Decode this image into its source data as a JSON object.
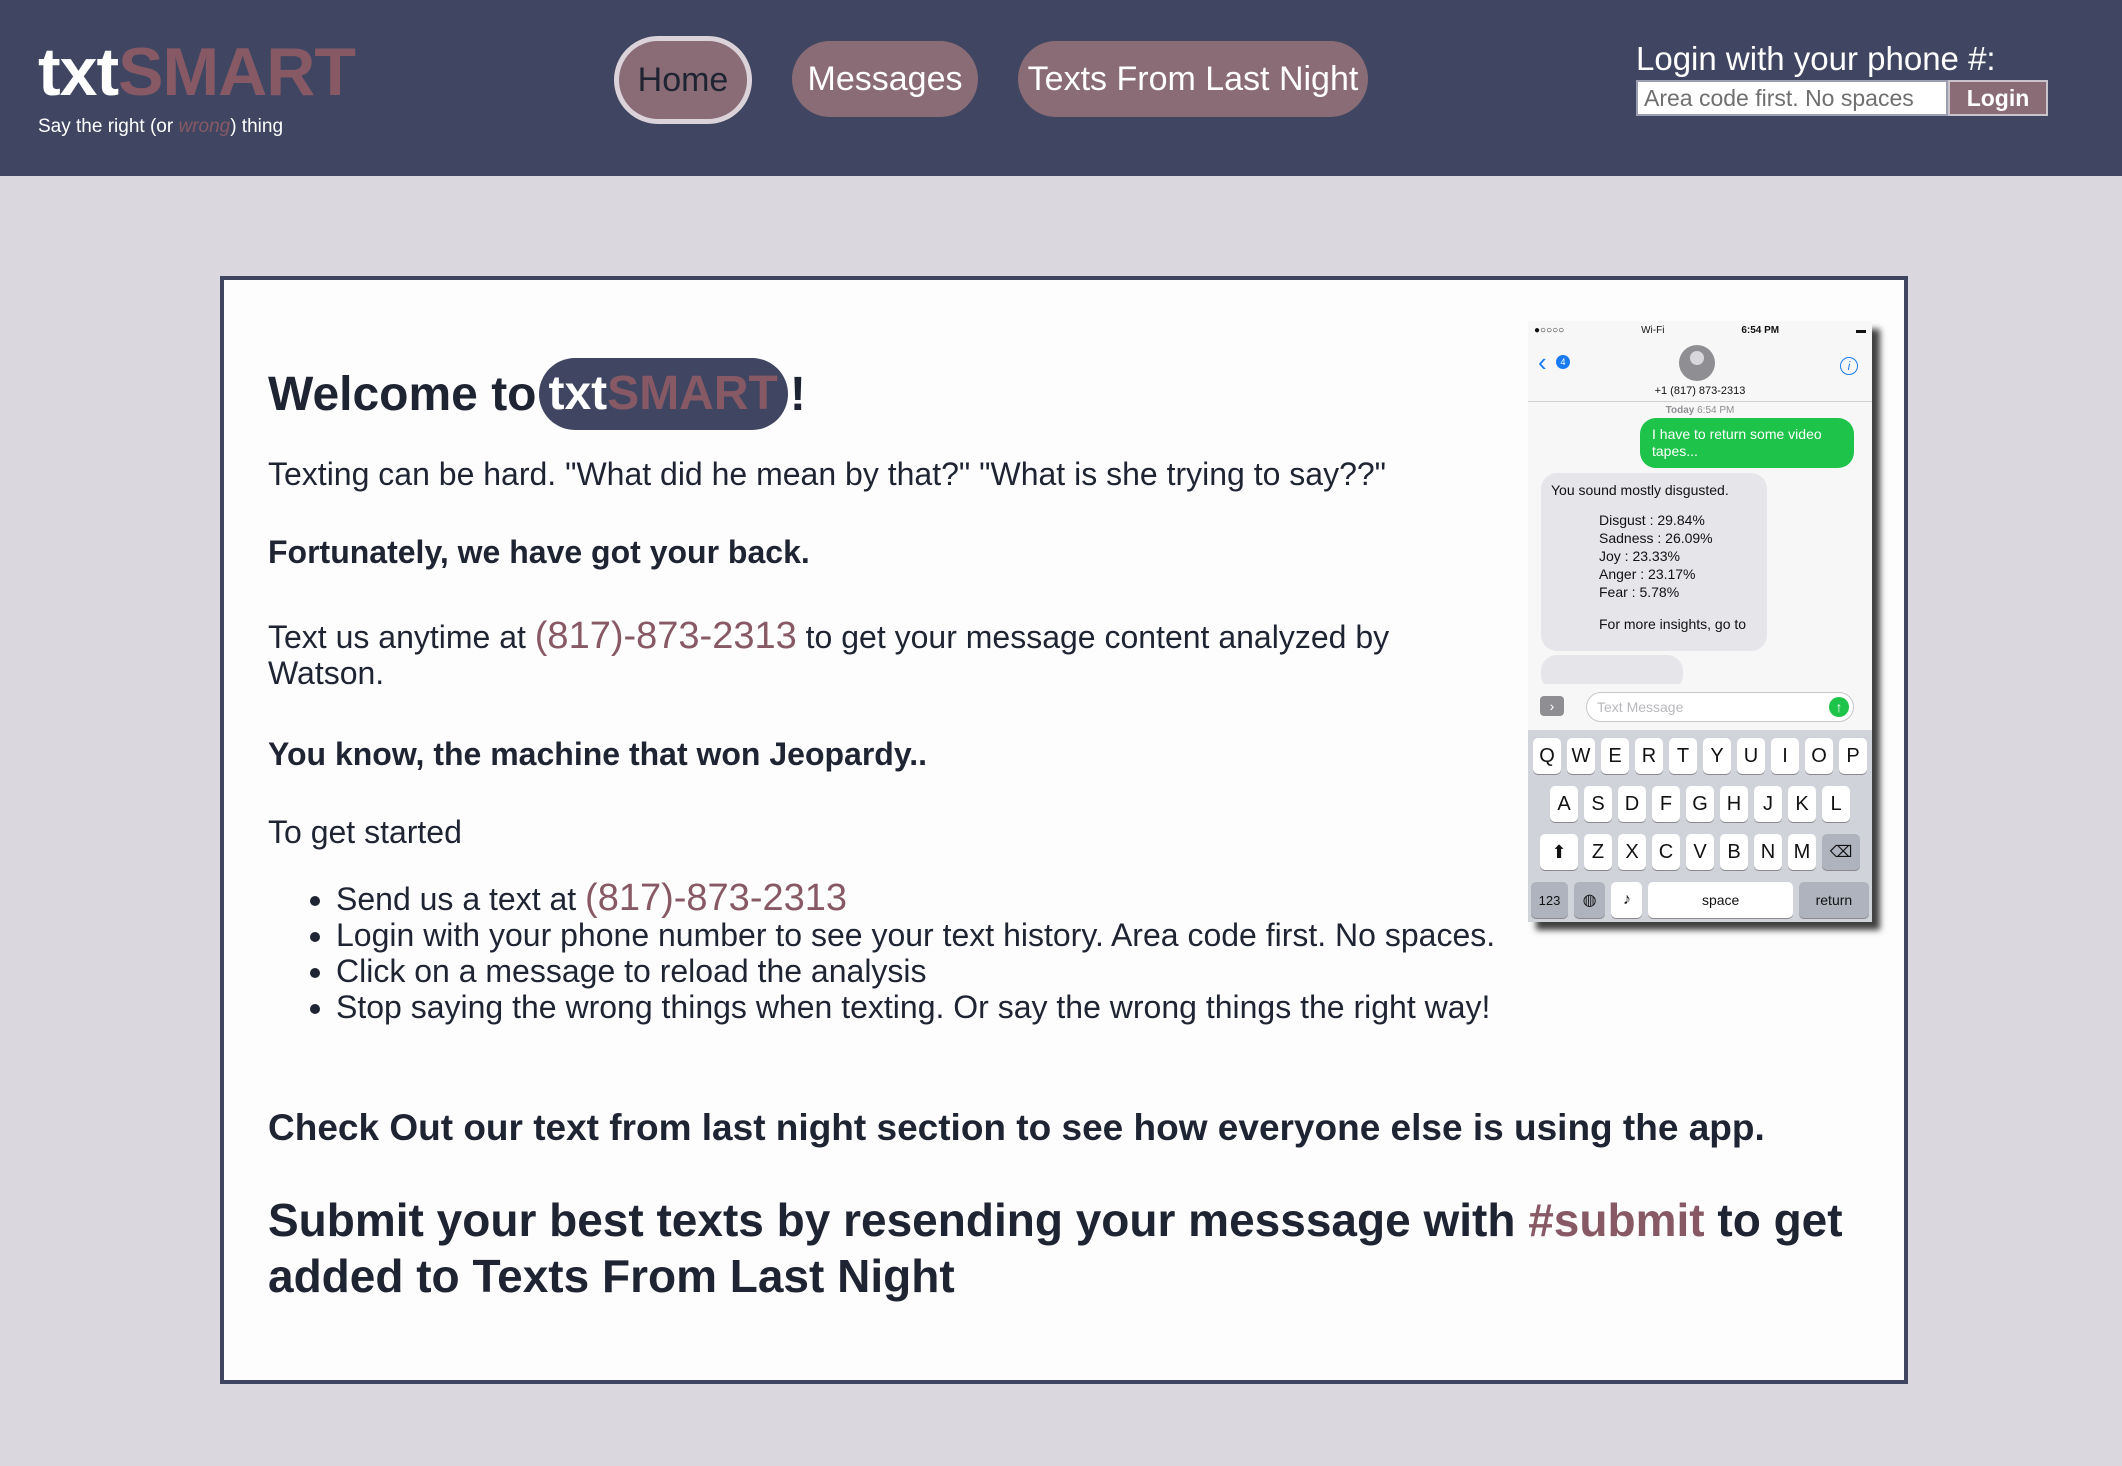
{
  "brand": {
    "name_prefix": "txt",
    "name_suffix": "SMART",
    "tagline_start": "Say the right (or ",
    "tagline_emphasis": "wrong",
    "tagline_end": ") thing",
    "colors": {
      "header_bg": "#404661",
      "accent": "#875965",
      "page_bg": "#dad7df",
      "nav_button": "#8a6c76"
    }
  },
  "nav": {
    "items": [
      {
        "label": "Home",
        "active": true
      },
      {
        "label": "Messages",
        "active": false
      },
      {
        "label": "Texts From Last Night",
        "active": false
      }
    ]
  },
  "login": {
    "label": "Login with your phone #:",
    "placeholder": "Area code first. No spaces",
    "button": "Login"
  },
  "content": {
    "welcome_prefix": "Welcome to",
    "welcome_suffix": "!",
    "intro": "Texting can be hard. \"What did he mean by that?\" \"What is she trying to say??\"",
    "fortunately": "Fortunately, we have got your back.",
    "text_us_before": "Text us anytime at ",
    "phone_number": "(817)-873-2313",
    "text_us_after": " to get your message content analyzed by Watson.",
    "jeopardy": "You know, the machine that won Jeopardy..",
    "to_get_started": "To get started",
    "steps": [
      "Send us a text at ",
      "Login with your phone number to see your text history. Area code first. No spaces.",
      "Click on a message to reload the analysis",
      "Stop saying the wrong things when texting. Or say the wrong things the right way!"
    ],
    "check_out": "Check Out our text from last night section to see how everyone else is using the app.",
    "submit_before": "Submit your best texts by resending your messsage with ",
    "submit_tag": "#submit",
    "submit_after": " to get added to Texts From Last Night"
  },
  "phone_screenshot": {
    "status_signal": "●○○○○",
    "status_wifi": "Wi-Fi",
    "status_time": "6:54 PM",
    "back_badge": "4",
    "contact_number": "+1 (817) 873-2313",
    "date_label": "Today",
    "date_time": "6:54 PM",
    "sent_message": "I have to return some video tapes...",
    "reply_headline": "You sound mostly disgusted.",
    "reply_stats": [
      "Disgust : 29.84%",
      "Sadness : 26.09%",
      "Joy : 23.33%",
      "Anger : 23.17%",
      "Fear : 5.78%"
    ],
    "reply_more": "For more insights, go to",
    "compose_placeholder": "Text Message",
    "keyboard": {
      "row1": [
        "Q",
        "W",
        "E",
        "R",
        "T",
        "Y",
        "U",
        "I",
        "O",
        "P"
      ],
      "row2": [
        "A",
        "S",
        "D",
        "F",
        "G",
        "H",
        "J",
        "K",
        "L"
      ],
      "row3": [
        "Z",
        "X",
        "C",
        "V",
        "B",
        "N",
        "M"
      ],
      "key_123": "123",
      "key_space": "space",
      "key_return": "return"
    }
  }
}
